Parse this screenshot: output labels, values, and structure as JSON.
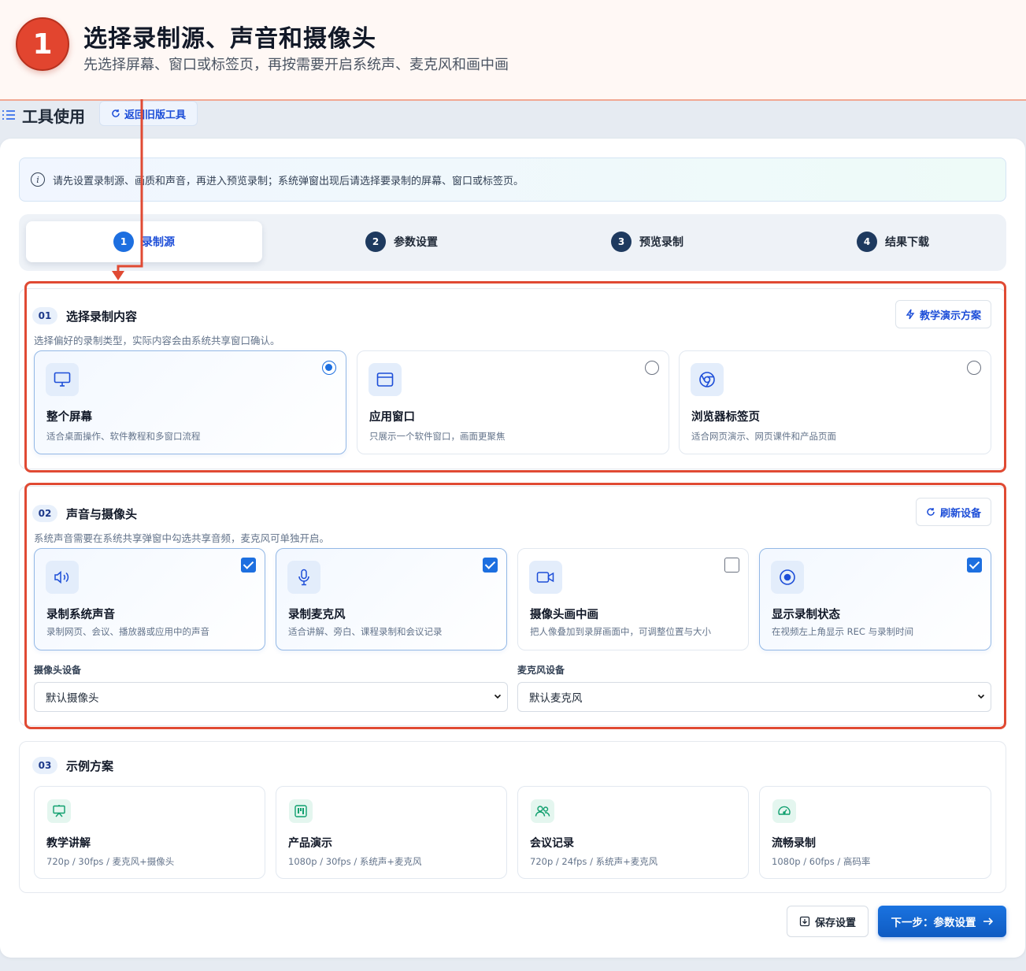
{
  "tutorial": {
    "step_number": "1",
    "title": "选择录制源、声音和摄像头",
    "subtitle": "先选择屏幕、窗口或标签页，再按需要开启系统声、麦克风和画中画"
  },
  "header": {
    "title": "工具使用",
    "back_button": "返回旧版工具"
  },
  "info_bar": {
    "text": "请先设置录制源、画质和声音，再进入预览录制；系统弹窗出现后请选择要录制的屏幕、窗口或标签页。"
  },
  "stepper": [
    {
      "num": "1",
      "label": "录制源",
      "active": true
    },
    {
      "num": "2",
      "label": "参数设置",
      "active": false
    },
    {
      "num": "3",
      "label": "预览录制",
      "active": false
    },
    {
      "num": "4",
      "label": "结果下载",
      "active": false
    }
  ],
  "section1": {
    "badge": "01",
    "title": "选择录制内容",
    "desc": "选择偏好的录制类型，实际内容会由系统共享窗口确认。",
    "action": "教学演示方案",
    "options": [
      {
        "title": "整个屏幕",
        "desc": "适合桌面操作、软件教程和多窗口流程",
        "selected": true,
        "icon": "monitor-icon"
      },
      {
        "title": "应用窗口",
        "desc": "只展示一个软件窗口，画面更聚焦",
        "selected": false,
        "icon": "app-window-icon"
      },
      {
        "title": "浏览器标签页",
        "desc": "适合网页演示、网页课件和产品页面",
        "selected": false,
        "icon": "browser-icon"
      }
    ]
  },
  "section2": {
    "badge": "02",
    "title": "声音与摄像头",
    "desc": "系统声音需要在系统共享弹窗中勾选共享音频，麦克风可单独开启。",
    "action": "刷新设备",
    "toggles": [
      {
        "title": "录制系统声音",
        "desc": "录制网页、会议、播放器或应用中的声音",
        "checked": true,
        "icon": "speaker-icon"
      },
      {
        "title": "录制麦克风",
        "desc": "适合讲解、旁白、课程录制和会议记录",
        "checked": true,
        "icon": "microphone-icon"
      },
      {
        "title": "摄像头画中画",
        "desc": "把人像叠加到录屏画面中，可调整位置与大小",
        "checked": false,
        "icon": "camera-icon"
      },
      {
        "title": "显示录制状态",
        "desc": "在视频左上角显示 REC 与录制时间",
        "checked": true,
        "icon": "record-icon"
      }
    ],
    "camera_label": "摄像头设备",
    "camera_value": "默认摄像头",
    "mic_label": "麦克风设备",
    "mic_value": "默认麦克风"
  },
  "section3": {
    "badge": "03",
    "title": "示例方案",
    "scenes": [
      {
        "title": "教学讲解",
        "desc": "720p / 30fps / 麦克风+摄像头",
        "icon": "presentation-board-icon"
      },
      {
        "title": "产品演示",
        "desc": "1080p / 30fps / 系统声+麦克风",
        "icon": "kanban-icon"
      },
      {
        "title": "会议记录",
        "desc": "720p / 24fps / 系统声+麦克风",
        "icon": "users-icon"
      },
      {
        "title": "流畅录制",
        "desc": "1080p / 60fps / 高码率",
        "icon": "gauge-icon"
      }
    ]
  },
  "footer": {
    "save": "保存设置",
    "next": "下一步：参数设置"
  },
  "colors": {
    "accent": "#1d6fe0",
    "highlight": "#e04a33",
    "step_circle": "#e2452f"
  }
}
